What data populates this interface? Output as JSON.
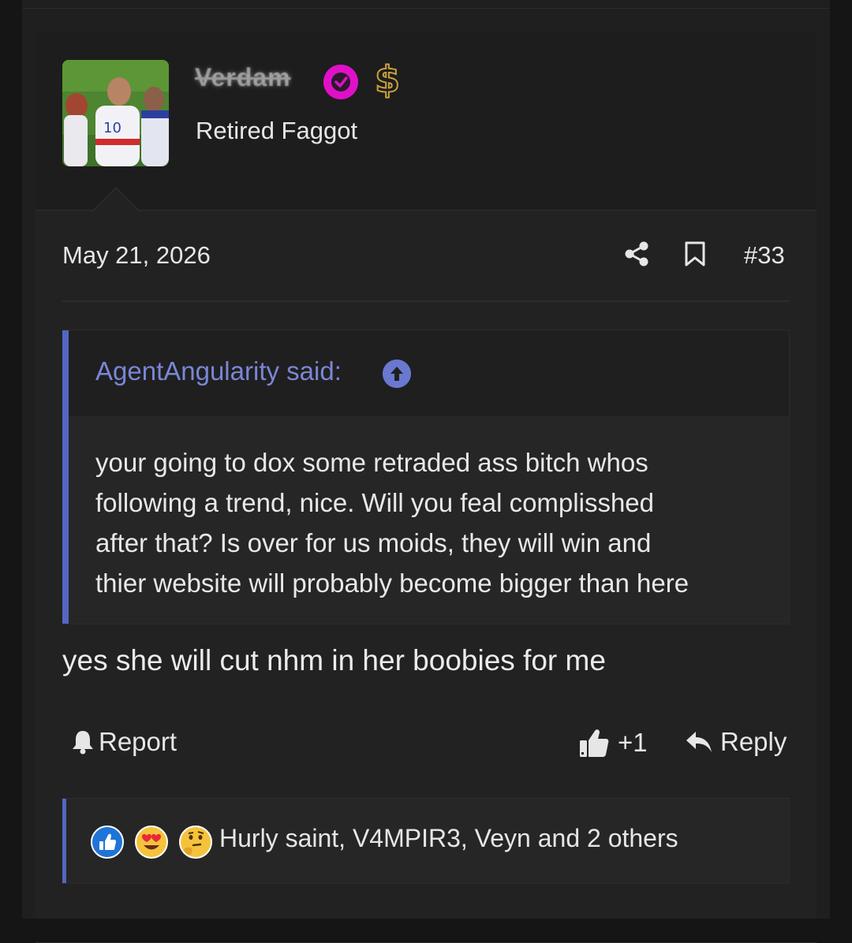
{
  "post": {
    "username": "Verdam",
    "user_title": "Retired Faggot",
    "date": "May 21, 2026",
    "post_number": "#33",
    "quote": {
      "author": "AgentAngularity said:",
      "lines": [
        "your going to dox some retraded ass bitch whos",
        "following a trend, nice. Will you feal complisshed",
        "after that? Is over for us moids, they will win and",
        "thier website will probably become bigger than here"
      ]
    },
    "body": "yes she will cut nhm in her boobies for me",
    "actions": {
      "report_label": "Report",
      "like_label": "+1",
      "reply_label": "Reply"
    },
    "reactions": {
      "icons": [
        "thumbs-up-reaction-icon",
        "heart-eyes-reaction-icon",
        "thinking-reaction-icon"
      ],
      "summary": "Hurly saint, V4MPIR3, Veyn and 2 others"
    }
  },
  "colors": {
    "accent": "#5566c2",
    "quote_author": "#7a86d6",
    "verified_badge": "#e010c8",
    "dollar_badge": "#c9a23c",
    "background": "#222222"
  }
}
